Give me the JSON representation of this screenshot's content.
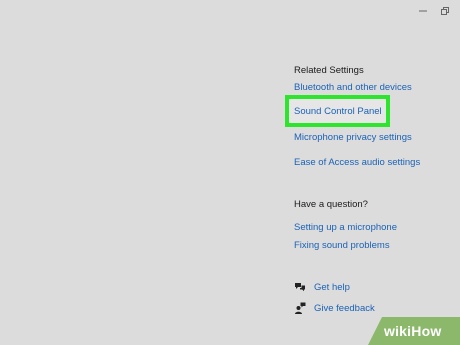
{
  "window_controls": {
    "minimize_icon": "minimize-icon",
    "restore_icon": "restore-icon"
  },
  "related_settings": {
    "title": "Related Settings",
    "links": {
      "bluetooth": "Bluetooth and other devices",
      "sound_control_panel": "Sound Control Panel",
      "microphone_privacy": "Microphone privacy settings",
      "ease_of_access": "Ease of Access audio settings"
    }
  },
  "have_a_question": {
    "title": "Have a question?",
    "links": {
      "setting_up_microphone": "Setting up a microphone",
      "fixing_sound": "Fixing sound problems"
    }
  },
  "help": {
    "get_help": "Get help",
    "give_feedback": "Give feedback"
  },
  "highlight_color": "#2de52d",
  "link_color": "#1b62b6",
  "watermark": {
    "wiki": "wiki",
    "how": "How",
    "color": "#8cb86b"
  }
}
